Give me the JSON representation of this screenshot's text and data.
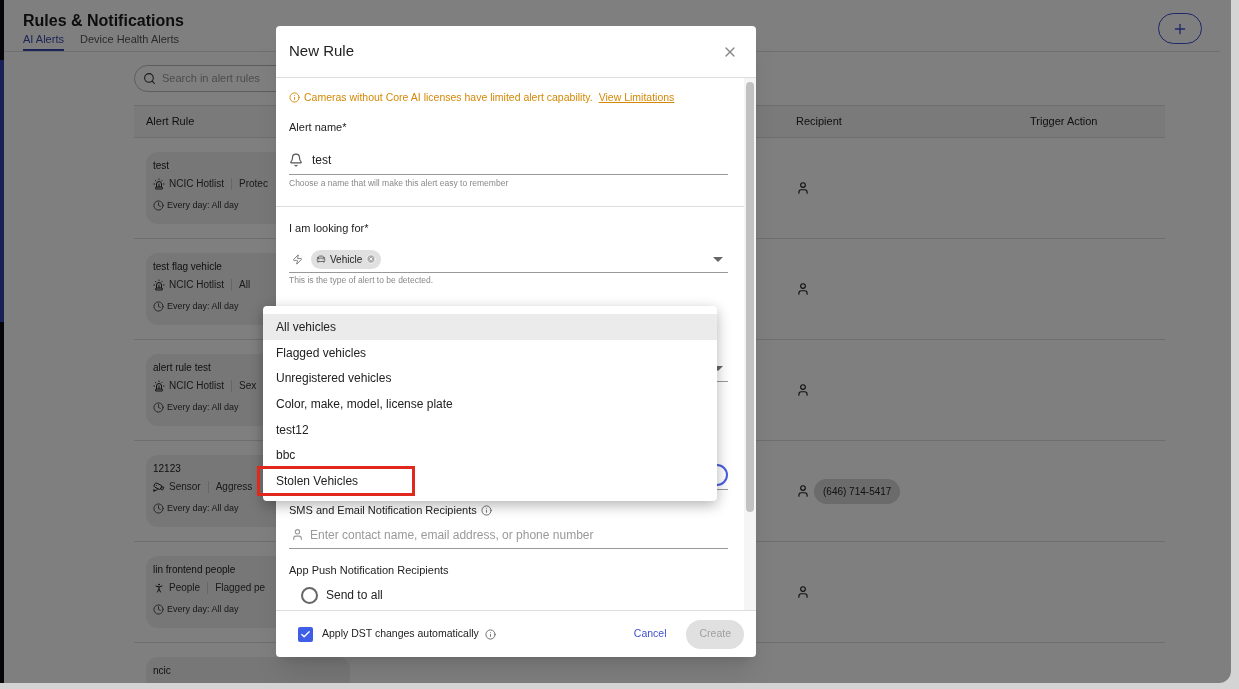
{
  "page": {
    "title": "Rules & Notifications",
    "tabs": [
      {
        "label": "AI Alerts",
        "selected": true
      },
      {
        "label": "Device Health Alerts",
        "selected": false
      }
    ],
    "search": {
      "placeholder": "Search in alert rules"
    },
    "table": {
      "columns": [
        "Alert Rule",
        "Recipient",
        "Trigger Action"
      ],
      "rows": [
        {
          "name": "test",
          "kind": "hotlist",
          "category": "NCIC Hotlist",
          "detail": "Protec",
          "schedule": "Every day: All day",
          "recipient_shown": true
        },
        {
          "name": "test flag vehicle",
          "kind": "hotlist",
          "category": "NCIC Hotlist",
          "detail": "All",
          "schedule": "Every day: All day",
          "recipient_shown": true
        },
        {
          "name": "alert rule test",
          "kind": "hotlist",
          "category": "NCIC Hotlist",
          "detail": "Sex",
          "schedule": "Every day: All day",
          "recipient_shown": true
        },
        {
          "name": "12123",
          "kind": "sensor",
          "category": "Sensor",
          "detail": "Aggress",
          "schedule": "Every day: All day",
          "recipient_shown": true,
          "recipient_chip": "(646) 714-5417"
        },
        {
          "name": "lin frontend people",
          "kind": "people",
          "category": "People",
          "detail": "Flagged pe",
          "schedule": "Every day: All day",
          "recipient_shown": true
        },
        {
          "name": "ncic"
        }
      ]
    }
  },
  "modal": {
    "title": "New Rule",
    "notice": {
      "text": "Cameras without Core AI licenses have limited alert capability.",
      "link": "View Limitations"
    },
    "alert_name": {
      "label": "Alert name*",
      "value": "test",
      "helper": "Choose a name that will make this alert easy to remember"
    },
    "looking_for": {
      "label": "I am looking for*",
      "chips": [
        "Vehicle"
      ],
      "helper": "This is the type of alert to be detected."
    },
    "sms": {
      "label": "SMS and Email Notification Recipients",
      "placeholder": "Enter contact name, email address, or phone number"
    },
    "push": {
      "label": "App Push Notification Recipients",
      "options": [
        {
          "label": "Send to all",
          "selected": false
        }
      ]
    },
    "dst": {
      "label": "Apply DST changes automatically",
      "checked": true
    },
    "buttons": [
      {
        "label": "Cancel",
        "kind": "text",
        "disabled": false
      },
      {
        "label": "Create",
        "kind": "filled",
        "disabled": true
      }
    ],
    "dropdown": [
      {
        "label": "All vehicles",
        "highlighted": true,
        "annotated": false
      },
      {
        "label": "Flagged vehicles",
        "highlighted": false,
        "annotated": false
      },
      {
        "label": "Unregistered vehicles",
        "highlighted": false,
        "annotated": false
      },
      {
        "label": "Color, make, model, license plate",
        "highlighted": false,
        "annotated": false
      },
      {
        "label": "test12",
        "highlighted": false,
        "annotated": false
      },
      {
        "label": "bbc",
        "highlighted": false,
        "annotated": false
      },
      {
        "label": "Stolen Vehicles",
        "highlighted": false,
        "annotated": true
      }
    ]
  }
}
